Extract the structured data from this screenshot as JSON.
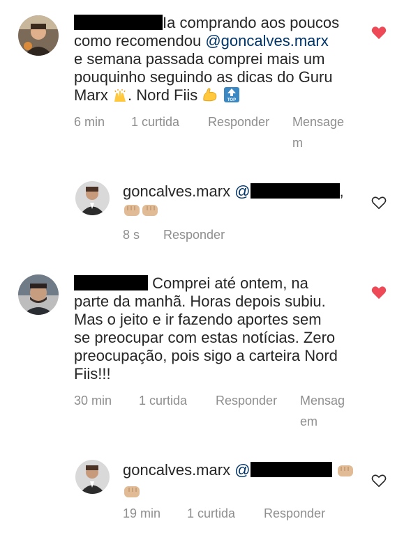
{
  "comments": [
    {
      "text_a": "Ia comprando aos poucos",
      "text_b": "como recomendou ",
      "mention": "@goncalves.marx",
      "text_c": "e semana passada comprei mais um",
      "text_d": "pouquinho seguindo as dicas do Guru",
      "text_e": "Marx",
      "text_f": ". Nord Fiis",
      "time": "6 min",
      "likes": "1 curtida",
      "reply": "Responder",
      "message_1": "Mensage",
      "message_2": "m",
      "liked": true,
      "reply_item": {
        "username": "goncalves.marx",
        "at": "@",
        "comma": ",",
        "time": "8 s",
        "reply": "Responder"
      }
    },
    {
      "text_a": "Comprei até ontem, na",
      "text_b": "parte da manhã. Horas depois subiu.",
      "text_c": "Mas o jeito e ir fazendo aportes sem",
      "text_d": "se preocupar com estas notícias. Zero",
      "text_e": "preocupação, pois sigo a carteira Nord",
      "text_f": "Fiis!!!",
      "time": "30 min",
      "likes": "1 curtida",
      "reply": "Responder",
      "message_1": "Mensag",
      "message_2": "em",
      "liked": true,
      "reply_item": {
        "username": "goncalves.marx",
        "at": "@",
        "time": "19 min",
        "likes": "1 curtida",
        "reply": "Responder"
      }
    }
  ],
  "colors": {
    "text": "#262626",
    "meta": "#8e8e8e",
    "mention": "#003569",
    "heart": "#ed4956"
  },
  "icons": [
    "heart-filled-icon",
    "heart-outline-icon",
    "raising-hands-emoji",
    "flexed-biceps-emoji",
    "top-arrow-emoji",
    "fist-bump-emoji"
  ]
}
